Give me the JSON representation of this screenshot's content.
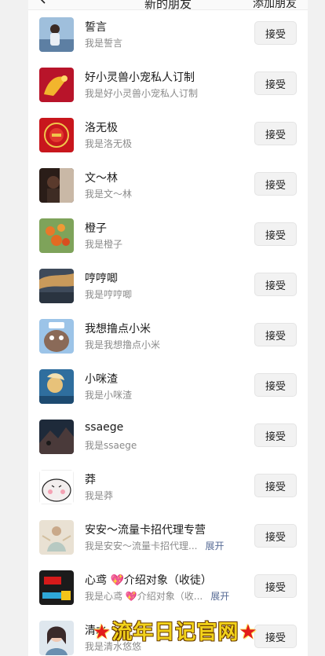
{
  "header": {
    "title": "新的朋友",
    "add_label": "添加朋友"
  },
  "friends": [
    {
      "name": "誓言",
      "message": "我是誓言",
      "accept_label": "接受"
    },
    {
      "name": "好小灵兽小宠私人订制",
      "message": "我是好小灵兽小宠私人订制",
      "accept_label": "接受"
    },
    {
      "name": "洛无极",
      "message": "我是洛无极",
      "accept_label": "接受"
    },
    {
      "name": "文～林",
      "message": "我是文～林",
      "accept_label": "接受"
    },
    {
      "name": "橙子",
      "message": "我是橙子",
      "accept_label": "接受"
    },
    {
      "name": "哼哼唧",
      "message": "我是哼哼唧",
      "accept_label": "接受"
    },
    {
      "name": "我想撸点小米",
      "message": "我是我想撸点小米",
      "accept_label": "接受"
    },
    {
      "name": "小咪渣",
      "message": "我是小咪渣",
      "accept_label": "接受"
    },
    {
      "name": "ssaege",
      "message": "我是ssaege",
      "accept_label": "接受"
    },
    {
      "name": "莽",
      "message": "我是莽",
      "accept_label": "接受"
    },
    {
      "name": "安安～流量卡招代理专营",
      "message": "我是安安～流量卡招代理...",
      "expand_label": "展开",
      "accept_label": "接受"
    },
    {
      "name": "心鸢 💖介绍对象（收徒）",
      "message": "我是心鸢 💖介绍对象（收...",
      "expand_label": "展开",
      "accept_label": "接受"
    },
    {
      "name": "清水",
      "message": "我是清水悠悠",
      "accept_label": "接受"
    }
  ],
  "watermark": {
    "star_left": "★",
    "text": "流年日记官网",
    "star_right": "★"
  },
  "colors": {
    "page_bg": "#f1f1f1",
    "card_bg": "#ffffff",
    "button_bg": "#f2f2f2",
    "link_blue": "#576b95",
    "watermark_yellow": "#f2d21b"
  }
}
